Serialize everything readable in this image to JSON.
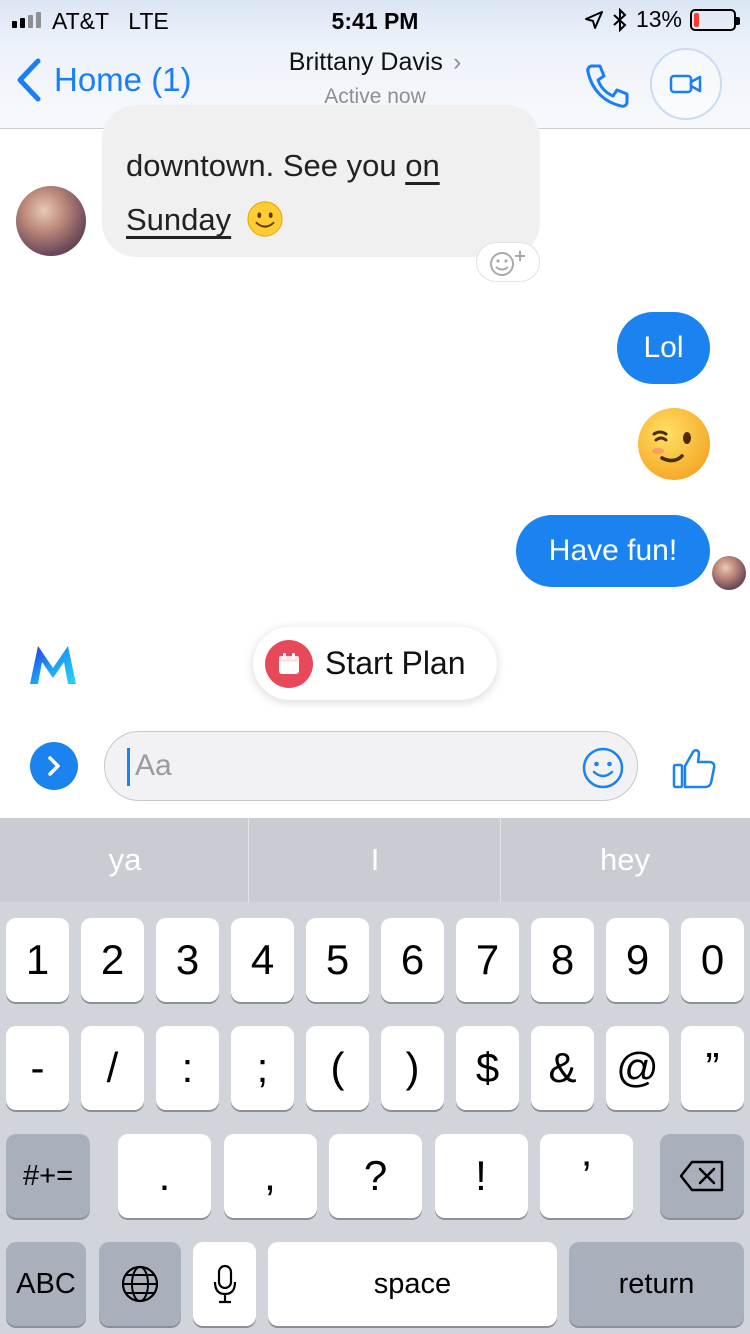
{
  "status_bar": {
    "carrier": "AT&T",
    "network": "LTE",
    "time": "5:41 PM",
    "battery_percent": "13%",
    "battery_level": 0.13,
    "battery_color": "#ff3b30"
  },
  "header": {
    "back_label": "Home (1)",
    "contact_name": "Brittany Davis",
    "contact_status": "Active now"
  },
  "messages": {
    "incoming_text": "downtown. See you",
    "incoming_link_1": "on",
    "incoming_link_2": "Sunday",
    "outgoing": [
      "Lol",
      "Have fun!"
    ]
  },
  "suggestion": {
    "chip_label": "Start Plan"
  },
  "composer": {
    "placeholder": "Aa"
  },
  "keyboard": {
    "predictions": [
      "ya",
      "I",
      "hey"
    ],
    "row1": [
      "1",
      "2",
      "3",
      "4",
      "5",
      "6",
      "7",
      "8",
      "9",
      "0"
    ],
    "row2": [
      "-",
      "/",
      ":",
      ";",
      "(",
      ")",
      "$",
      "&",
      "@",
      "”"
    ],
    "row3_mode": "#+=",
    "row3": [
      ".",
      ",",
      "?",
      "!",
      "’"
    ],
    "abc": "ABC",
    "space": "space",
    "return": "return"
  },
  "colors": {
    "accent": "#1a83f0",
    "incoming_bubble": "#f1f0f0",
    "plan_icon": "#e8495a"
  },
  "icons": [
    "signal-icon",
    "location-arrow-icon",
    "bluetooth-icon",
    "battery-icon",
    "back-chevron-icon",
    "phone-icon",
    "video-icon",
    "reaction-add-icon",
    "wink-emoji-icon",
    "messenger-m-icon",
    "calendar-icon",
    "expand-chevron-icon",
    "smiley-icon",
    "thumbs-up-icon",
    "backspace-icon",
    "globe-icon",
    "microphone-icon"
  ]
}
